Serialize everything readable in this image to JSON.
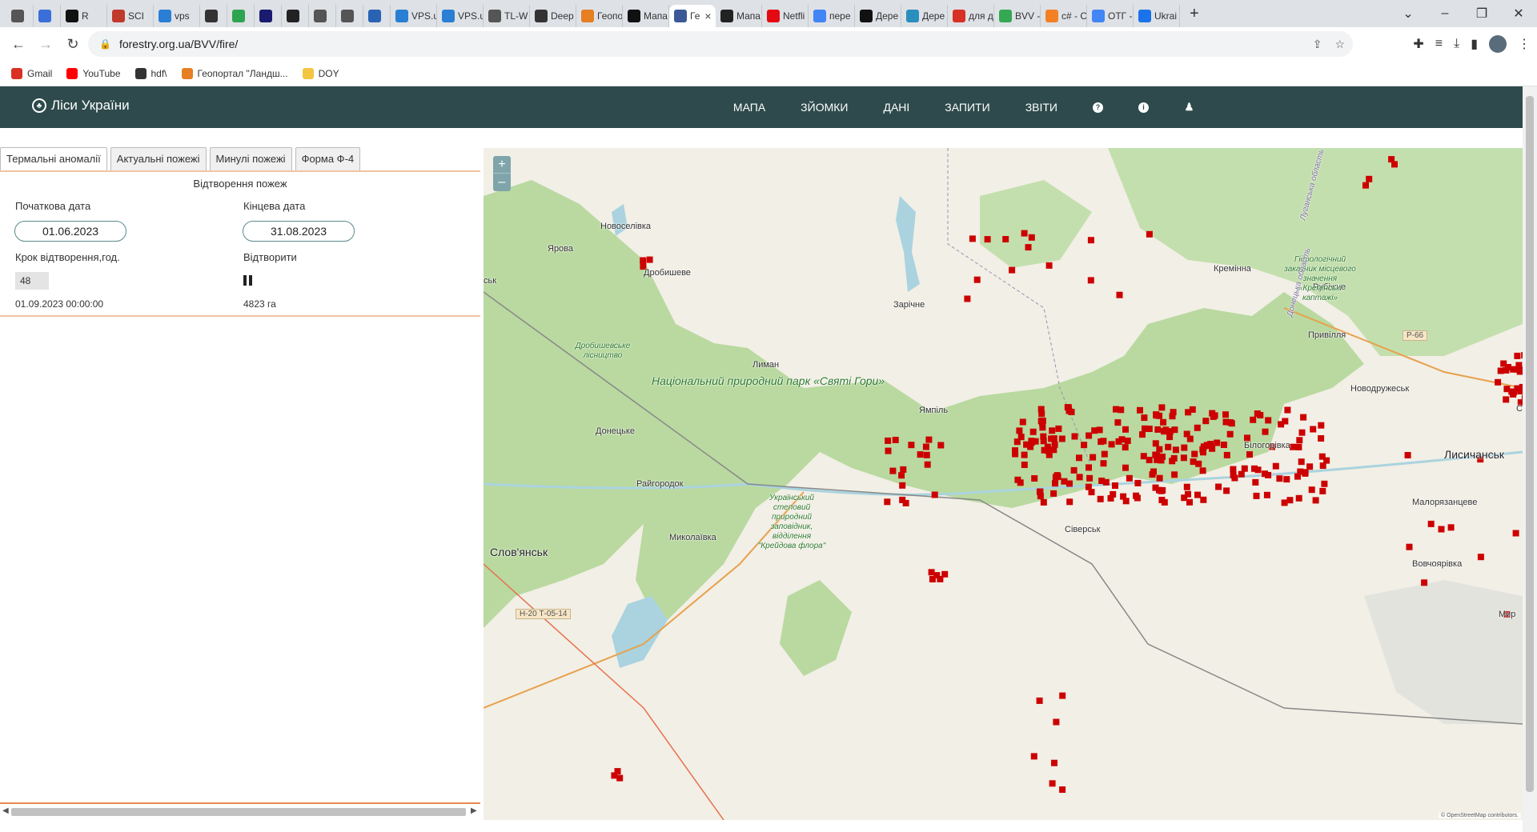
{
  "browser": {
    "tabs": [
      {
        "label": "",
        "color": "#555"
      },
      {
        "label": "",
        "color": "#3a6fd8"
      },
      {
        "label": "R",
        "color": "#111"
      },
      {
        "label": "SCI",
        "color": "#c0392b"
      },
      {
        "label": "vps",
        "color": "#2a7fd4"
      },
      {
        "label": "",
        "color": "#333"
      },
      {
        "label": "",
        "color": "#2ea44f"
      },
      {
        "label": "",
        "color": "#1a1a6e"
      },
      {
        "label": "",
        "color": "#222"
      },
      {
        "label": "",
        "color": "#555"
      },
      {
        "label": "",
        "color": "#555"
      },
      {
        "label": "",
        "color": "#2a62b4"
      },
      {
        "label": "VPS.u",
        "color": "#2a7fd4"
      },
      {
        "label": "VPS.u",
        "color": "#2a7fd4"
      },
      {
        "label": "TL-W",
        "color": "#555"
      },
      {
        "label": "Deep",
        "color": "#333"
      },
      {
        "label": "Геопо",
        "color": "#e67e22"
      },
      {
        "label": "Мапа",
        "color": "#111"
      },
      {
        "label": "Ге",
        "color": "#3b5998",
        "active": true
      },
      {
        "label": "Мапа",
        "color": "#222"
      },
      {
        "label": "Netfli",
        "color": "#e50914"
      },
      {
        "label": "пере",
        "color": "#4285f4"
      },
      {
        "label": "Дере",
        "color": "#111"
      },
      {
        "label": "Дере",
        "color": "#2a8fbd"
      },
      {
        "label": "для д",
        "color": "#d93025"
      },
      {
        "label": "BVV -",
        "color": "#34a853"
      },
      {
        "label": "c# - С",
        "color": "#f48024"
      },
      {
        "label": "ОТГ -",
        "color": "#4285f4"
      },
      {
        "label": "Ukrai",
        "color": "#1a73e8"
      }
    ],
    "url": "forestry.org.ua/BVV/fire/",
    "bookmarks": [
      {
        "label": "Gmail",
        "color": "#d93025"
      },
      {
        "label": "YouTube",
        "color": "#ff0000"
      },
      {
        "label": "hdf\\",
        "color": "#333"
      },
      {
        "label": "Геопортал \"Ландш...",
        "color": "#e67e22"
      },
      {
        "label": "DOY",
        "color": "#f4c542"
      }
    ]
  },
  "site": {
    "brand": "Ліси України",
    "nav": [
      "МАПА",
      "ЗЙОМКИ",
      "ДАНІ",
      "ЗАПИТИ",
      "ЗВІТИ"
    ],
    "nav_icons": [
      "help-icon",
      "info-icon",
      "user-icon"
    ],
    "accent": "#2e4a4c"
  },
  "panel": {
    "tabs": [
      "Термальні аномалії",
      "Актуальні пожежі",
      "Минулі пожежі",
      "Форма Ф-4"
    ],
    "title": "Відтворення пожеж",
    "start_label": "Початкова дата",
    "start_value": "01.06.2023",
    "end_label": "Кінцева дата",
    "end_value": "31.08.2023",
    "step_label": "Крок відтворення,год.",
    "step_value": "48",
    "play_label": "Відтворити",
    "current_datetime": "01.09.2023 00:00:00",
    "area": "4823 га"
  },
  "map": {
    "zoom_in": "+",
    "zoom_out": "–",
    "attribution": "© OpenStreetMap contributors.",
    "fire_color": "#cc0000",
    "places": [
      {
        "name": "Новоселівка",
        "cls": ""
      },
      {
        "name": "Ярова",
        "cls": ""
      },
      {
        "name": "Дробишеве",
        "cls": ""
      },
      {
        "name": "ськ",
        "cls": ""
      },
      {
        "name": "Зарічне",
        "cls": ""
      },
      {
        "name": "Кремінна",
        "cls": ""
      },
      {
        "name": "Рубіжне",
        "cls": ""
      },
      {
        "name": "Привілля",
        "cls": ""
      },
      {
        "name": "Лиман",
        "cls": ""
      },
      {
        "name": "Новодружеськ",
        "cls": ""
      },
      {
        "name": "Ямпіль",
        "cls": ""
      },
      {
        "name": "Донецьке",
        "cls": ""
      },
      {
        "name": "Білогорівка",
        "cls": ""
      },
      {
        "name": "Лисичанськ",
        "cls": "big"
      },
      {
        "name": "Райгородок",
        "cls": ""
      },
      {
        "name": "Малорязанцеве",
        "cls": ""
      },
      {
        "name": "Сіверськ",
        "cls": ""
      },
      {
        "name": "Миколаївка",
        "cls": ""
      },
      {
        "name": "Слов'янськ",
        "cls": "big"
      },
      {
        "name": "Вовчоярівка",
        "cls": ""
      },
      {
        "name": "Мир",
        "cls": ""
      },
      {
        "name": "Се",
        "cls": ""
      },
      {
        "name": "Р-66",
        "cls": "road"
      },
      {
        "name": "Дробишевське лісництво",
        "cls": "park-sm"
      },
      {
        "name": "Національний природний парк «Святі Гори»",
        "cls": "park"
      },
      {
        "name": "Гідрологічний заказник місцевого значення «Кремінські каптажі»",
        "cls": "park-sm"
      },
      {
        "name": "Український степовий природний заповідник, відділення \"Крейдова флора\"",
        "cls": "park-sm"
      },
      {
        "name": "Н-20 Т-05-14",
        "cls": "road"
      },
      {
        "name": "Луганська область",
        "cls": "park-sm"
      },
      {
        "name": "Донецька область",
        "cls": "park-sm"
      }
    ]
  }
}
